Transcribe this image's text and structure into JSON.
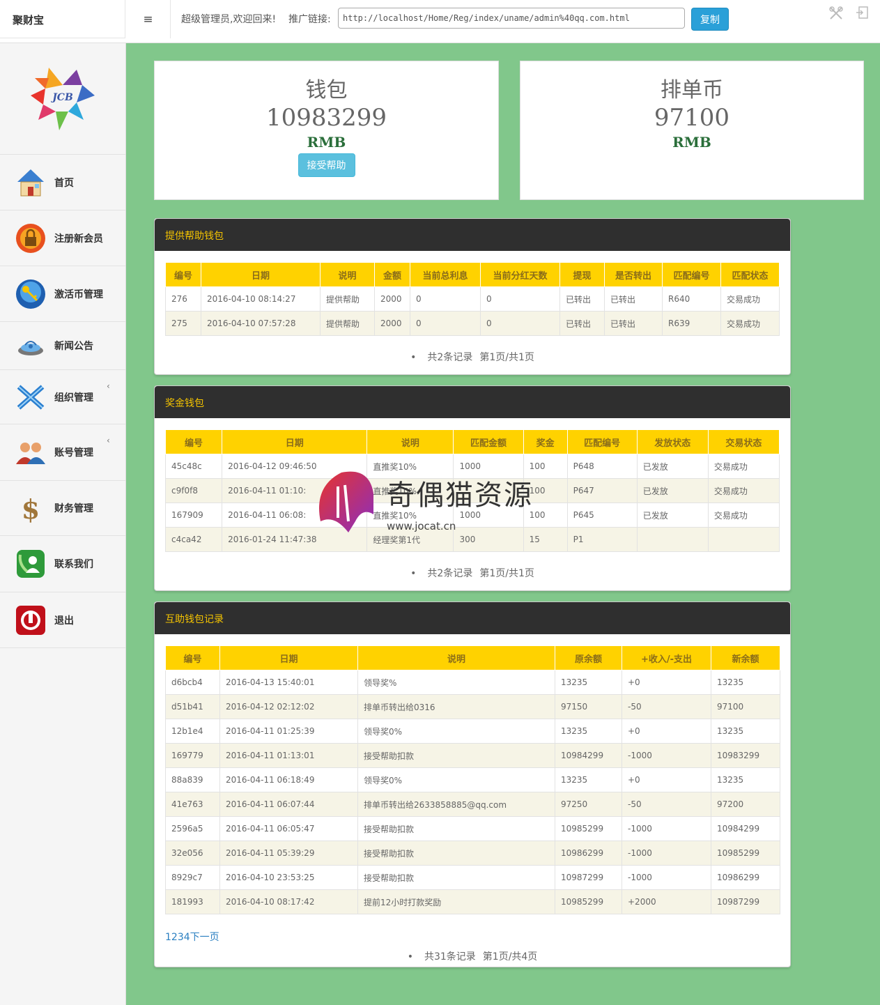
{
  "header": {
    "brand": "聚财宝",
    "welcome": "超级管理员,欢迎回来!",
    "promo_label": "推广链接:",
    "promo_url": "http://localhost/Home/Reg/index/uname/admin%40qq.com.html",
    "copy_label": "复制"
  },
  "sidebar": {
    "logo_text": "JCB",
    "items": [
      {
        "label": "首页",
        "icon": "house-icon"
      },
      {
        "label": "注册新会员",
        "icon": "lock-icon"
      },
      {
        "label": "激活币管理",
        "icon": "key-icon"
      },
      {
        "label": "新闻公告",
        "icon": "broadcast-icon"
      },
      {
        "label": "组织管理",
        "icon": "network-icon",
        "chevron": "‹"
      },
      {
        "label": "账号管理",
        "icon": "users-icon",
        "chevron": "‹"
      },
      {
        "label": "财务管理",
        "icon": "dollar-icon"
      },
      {
        "label": "联系我们",
        "icon": "phone-contact-icon"
      },
      {
        "label": "退出",
        "icon": "power-icon"
      }
    ]
  },
  "stats": {
    "wallet": {
      "title": "钱包",
      "value": "10983299",
      "unit": "RMB",
      "button": "接受帮助"
    },
    "queue": {
      "title": "排单币",
      "value": "97100",
      "unit": "RMB"
    }
  },
  "provide": {
    "title": "提供帮助钱包",
    "headers": [
      "编号",
      "日期",
      "说明",
      "金额",
      "当前总利息",
      "当前分红天数",
      "提现",
      "是否转出",
      "匹配编号",
      "匹配状态"
    ],
    "rows": [
      [
        "276",
        "2016-04-10 08:14:27",
        "提供帮助",
        "2000",
        "0",
        "0",
        "已转出",
        "已转出",
        "R640",
        "交易成功"
      ],
      [
        "275",
        "2016-04-10 07:57:28",
        "提供帮助",
        "2000",
        "0",
        "0",
        "已转出",
        "已转出",
        "R639",
        "交易成功"
      ]
    ],
    "pager": {
      "dot": "•",
      "count": "共2条记录",
      "page": "第1页/共1页"
    }
  },
  "bonus": {
    "title": "奖金钱包",
    "headers": [
      "编号",
      "日期",
      "说明",
      "匹配金额",
      "奖金",
      "匹配编号",
      "发放状态",
      "交易状态"
    ],
    "rows": [
      [
        "45c48c",
        "2016-04-12 09:46:50",
        "直推奖10%",
        "1000",
        "100",
        "P648",
        "已发放",
        "交易成功"
      ],
      [
        "c9f0f8",
        "2016-04-11 01:10:",
        "直推奖10%",
        "",
        "100",
        "P647",
        "已发放",
        "交易成功"
      ],
      [
        "167909",
        "2016-04-11 06:08:",
        "直推奖10%",
        "1000",
        "100",
        "P645",
        "已发放",
        "交易成功"
      ],
      [
        "c4ca42",
        "2016-01-24 11:47:38",
        "经理奖第1代",
        "300",
        "15",
        "P1",
        "",
        ""
      ]
    ],
    "pager": {
      "dot": "•",
      "count": "共2条记录",
      "page": "第1页/共1页"
    }
  },
  "mutual": {
    "title": "互助钱包记录",
    "headers": [
      "编号",
      "日期",
      "说明",
      "原余额",
      "+收入/-支出",
      "新余额"
    ],
    "rows": [
      [
        "d6bcb4",
        "2016-04-13 15:40:01",
        "领导奖%",
        "13235",
        "+0",
        "13235"
      ],
      [
        "d51b41",
        "2016-04-12 02:12:02",
        "排单币转出给0316",
        "97150",
        "-50",
        "97100"
      ],
      [
        "12b1e4",
        "2016-04-11 01:25:39",
        "领导奖0%",
        "13235",
        "+0",
        "13235"
      ],
      [
        "169779",
        "2016-04-11 01:13:01",
        "接受帮助扣款",
        "10984299",
        "-1000",
        "10983299"
      ],
      [
        "88a839",
        "2016-04-11 06:18:49",
        "领导奖0%",
        "13235",
        "+0",
        "13235"
      ],
      [
        "41e763",
        "2016-04-11 06:07:44",
        "排单币转出给2633858885@qq.com",
        "97250",
        "-50",
        "97200"
      ],
      [
        "2596a5",
        "2016-04-11 06:05:47",
        "接受帮助扣款",
        "10985299",
        "-1000",
        "10984299"
      ],
      [
        "32e056",
        "2016-04-11 05:39:29",
        "接受帮助扣款",
        "10986299",
        "-1000",
        "10985299"
      ],
      [
        "8929c7",
        "2016-04-10 23:53:25",
        "接受帮助扣款",
        "10987299",
        "-1000",
        "10986299"
      ],
      [
        "181993",
        "2016-04-10 08:17:42",
        "提前12小时打款奖励",
        "10985299",
        "+2000",
        "10987299"
      ]
    ],
    "page_links": "1234下一页",
    "pager": {
      "dot": "•",
      "count": "共31条记录",
      "page": "第1页/共4页"
    }
  },
  "watermark": {
    "text": "奇偶猫资源",
    "url": "www.jocat.cn"
  }
}
